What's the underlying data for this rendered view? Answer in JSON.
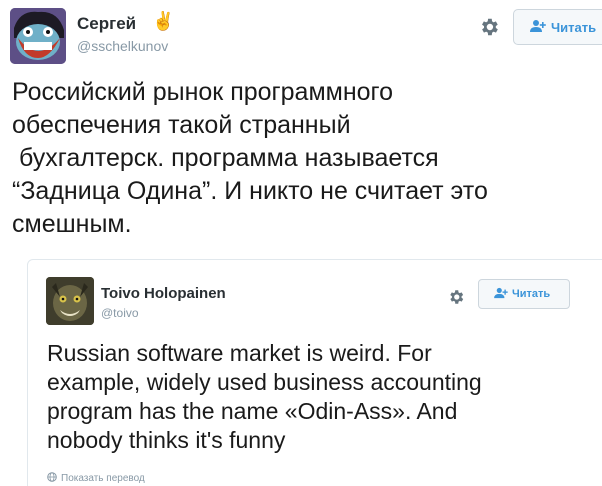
{
  "tweet": {
    "author_name": "Сергей",
    "author_handle": "@sschelkunov",
    "follow_label": "Читать",
    "text_lines": [
      "Российский рынок программного",
      "обеспечения такой странный",
      "бухгалтерск. программа называется",
      "“Задница Одина”. И никто не считает это",
      "смешным."
    ]
  },
  "quoted": {
    "author_name": "Toivo Holopainen",
    "author_handle": "@toivo",
    "follow_label": "Читать",
    "text_lines": [
      "Russian software market is weird. For",
      "example, widely used business accounting",
      "program has the name «Odin-Ass». And",
      "nobody thinks it's funny"
    ],
    "translate_label": "Показать перевод"
  },
  "icons": {
    "victory": "victory-hand-icon",
    "gear": "gear-icon",
    "follow": "follow-user-icon",
    "globe": "globe-icon"
  },
  "colors": {
    "link_blue": "#3b94d9",
    "handle_gray": "#8899a6",
    "text_dark": "#1a1a1a"
  }
}
